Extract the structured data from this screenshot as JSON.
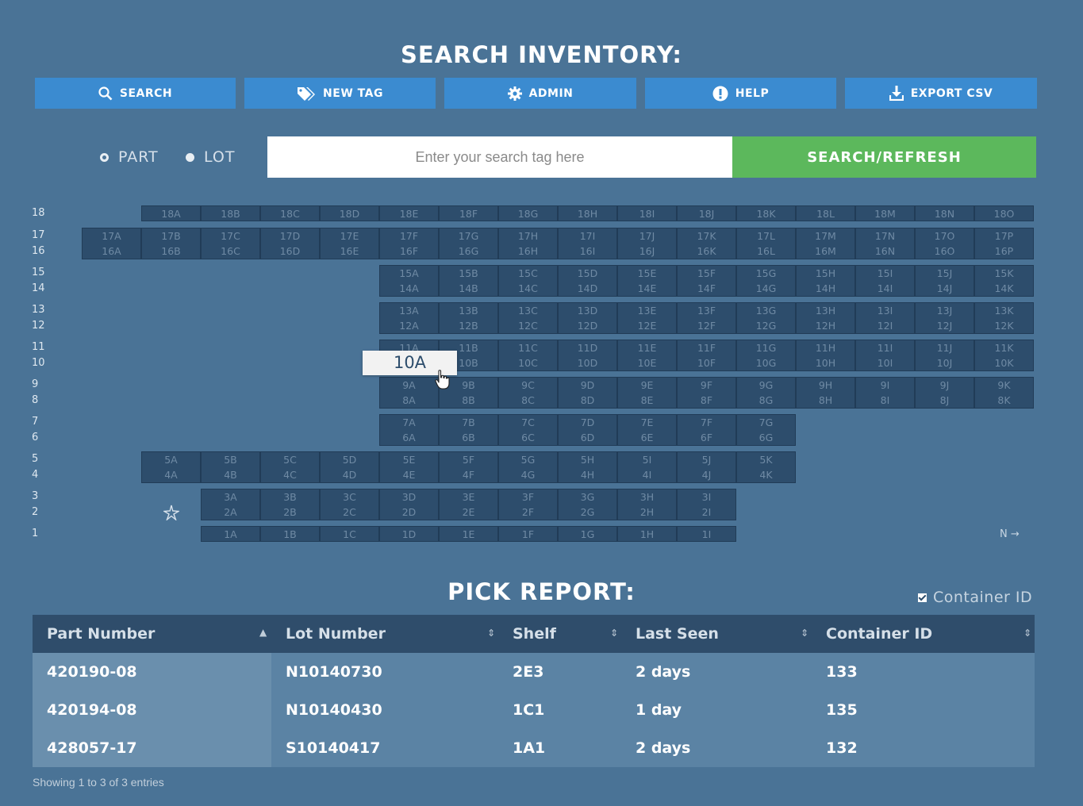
{
  "page": {
    "search_title": "SEARCH INVENTORY:",
    "pick_title": "PICK REPORT:"
  },
  "nav": [
    {
      "label": "SEARCH",
      "icon": "search-icon"
    },
    {
      "label": "NEW TAG",
      "icon": "tag-icon"
    },
    {
      "label": "ADMIN",
      "icon": "gear-icon"
    },
    {
      "label": "HELP",
      "icon": "exclamation-icon"
    },
    {
      "label": "EXPORT CSV",
      "icon": "download-icon"
    }
  ],
  "search": {
    "mode_part": "PART",
    "mode_lot": "LOT",
    "selected_mode": "PART",
    "placeholder": "Enter your search tag here",
    "button": "SEARCH/REFRESH"
  },
  "shelf_map": {
    "rows": [
      {
        "label": "18",
        "columns": "ABCDEFGHIJKLMNO"
      },
      {
        "label": "17",
        "columns": "ABCDEFGHIJKLMNOP"
      },
      {
        "label": "16",
        "columns": "ABCDEFGHIJKLMNOP"
      },
      {
        "label": "15",
        "columns": "ABCDEFGHIJK"
      },
      {
        "label": "14",
        "columns": "ABCDEFGHIJK"
      },
      {
        "label": "13",
        "columns": "ABCDEFGHIJK"
      },
      {
        "label": "12",
        "columns": "ABCDEFGHIJK"
      },
      {
        "label": "11",
        "columns": "ABCDEFGHIJK"
      },
      {
        "label": "10",
        "columns": "ABCDEFGHIJK"
      },
      {
        "label": "9",
        "columns": "ABCDEFGHIJK"
      },
      {
        "label": "8",
        "columns": "ABCDEFGHIJK"
      },
      {
        "label": "7",
        "columns": "ABCDEFG"
      },
      {
        "label": "6",
        "columns": "ABCDEFG"
      },
      {
        "label": "5",
        "columns": "ABCDEFGHIJK"
      },
      {
        "label": "4",
        "columns": "ABCDEFGHIJK"
      },
      {
        "label": "3",
        "columns": "ABCDEFGHI"
      },
      {
        "label": "2",
        "columns": "ABCDEFGHI"
      },
      {
        "label": "1",
        "columns": "ABCDEFGHI"
      }
    ],
    "hovered_cell": "10A",
    "north_label": "N →"
  },
  "pick_report": {
    "container_toggle": "Container ID",
    "container_checked": true,
    "columns": [
      "Part Number",
      "Lot Number",
      "Shelf",
      "Last Seen",
      "Container ID"
    ],
    "rows": [
      [
        "420190-08",
        "N10140730",
        "2E3",
        "2 days",
        "133"
      ],
      [
        "420194-08",
        "N10140430",
        "1C1",
        "1 day",
        "135"
      ],
      [
        "428057-17",
        "S10140417",
        "1A1",
        "2 days",
        "132"
      ]
    ],
    "footer": "Showing 1 to 3 of 3 entries"
  }
}
